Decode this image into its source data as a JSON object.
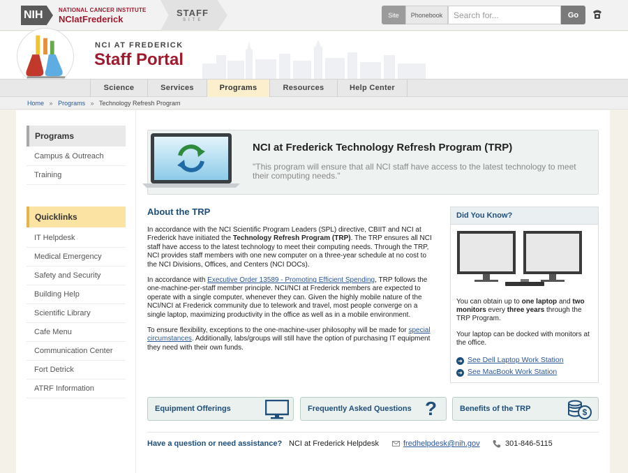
{
  "topbar": {
    "logo_nih": "NIH",
    "logo_line1": "NATIONAL CANCER INSTITUTE",
    "logo_line2": "NCIatFrederick",
    "staff": "STAFF",
    "site": "SITE",
    "scope_site": "Site",
    "scope_phonebook": "Phonebook",
    "search_placeholder": "Search for...",
    "go": "Go"
  },
  "header": {
    "eyebrow": "NCI AT FREDERICK",
    "title": "Staff Portal"
  },
  "nav": [
    "Science",
    "Services",
    "Programs",
    "Resources",
    "Help Center"
  ],
  "nav_active": "Programs",
  "breadcrumb": [
    "Home",
    "Programs",
    "Technology Refresh Program"
  ],
  "sidebar": {
    "programs_head": "Programs",
    "programs": [
      "Campus & Outreach",
      "Training"
    ],
    "quicklinks_head": "Quicklinks",
    "quicklinks": [
      "IT Helpdesk",
      "Medical Emergency",
      "Safety and Security",
      "Building Help",
      "Scientific Library",
      "Cafe Menu",
      "Communication Center",
      "Fort Detrick",
      "ATRF Information"
    ]
  },
  "banner": {
    "title": "NCI at Frederick Technology Refresh Program (TRP)",
    "quote": "\"This program will ensure that all NCI staff have access to the latest technology to meet their computing needs.\""
  },
  "about": {
    "title": "About the TRP",
    "p1_a": "In accordance with the NCI Scientific Program Leaders (SPL) directive, CBIIT and NCI at Frederick have initiated the ",
    "p1_bold": "Technology Refresh Program (TRP)",
    "p1_b": ". The TRP ensures all NCI staff have access to the latest technology to meet their computing needs. Through the TRP, NCI provides staff members with one new computer on a three-year schedule at no cost to the NCI Divisions, Offices, and Centers (NCI DOCs).",
    "p2_a": "In accordance with ",
    "p2_link": "Executive Order 13589 - Promoting Efficient Spending",
    "p2_b": ", TRP follows the one-machine-per-staff member principle. NCI/NCI at Frederick members are expected to operate with a single computer, whenever they can. Given the highly mobile nature of the NCI/NCI at Frederick community due to telework and travel, most people converge on a single laptop, maximizing productivity in the office as well as in a mobile environment.",
    "p3_a": "To ensure flexibility, exceptions to the one-machine-user philosophy will be made for ",
    "p3_link": "special circumstances",
    "p3_b": ". Additionally, labs/groups will still have the option of purchasing IT equipment they need with their own funds."
  },
  "dyk": {
    "head": "Did You Know?",
    "t1": "You can obtain up to ",
    "t1_b1": "one laptop",
    "t1_2": " and ",
    "t1_b2": "two monitors",
    "t1_3": " every ",
    "t1_b3": "three years",
    "t1_4": " through the TRP Program.",
    "t2": "Your laptop can be docked with monitors at the office.",
    "link1": "See Dell Laptop Work Station",
    "link2": "See MacBook Work Station"
  },
  "cards": [
    "Equipment Offerings",
    "Frequently Asked Questions",
    "Benefits of the TRP"
  ],
  "footer": {
    "question": "Have a question or need assistance?",
    "desk": "NCI at Frederick Helpdesk",
    "email": "fredhelpdesk@nih.gov",
    "phone": "301-846-5115"
  },
  "icons": {
    "phone": "phone-icon",
    "mail": "envelope-icon",
    "refresh": "refresh-icon",
    "monitor": "monitor-icon",
    "question": "question-mark-icon",
    "coins": "coins-dollar-icon",
    "arrow": "arrow-circle-icon"
  },
  "colors": {
    "brand_red": "#a0192c",
    "link_blue": "#2b5797",
    "heading_blue": "#1f4e79",
    "active_nav": "#fbefcd"
  }
}
